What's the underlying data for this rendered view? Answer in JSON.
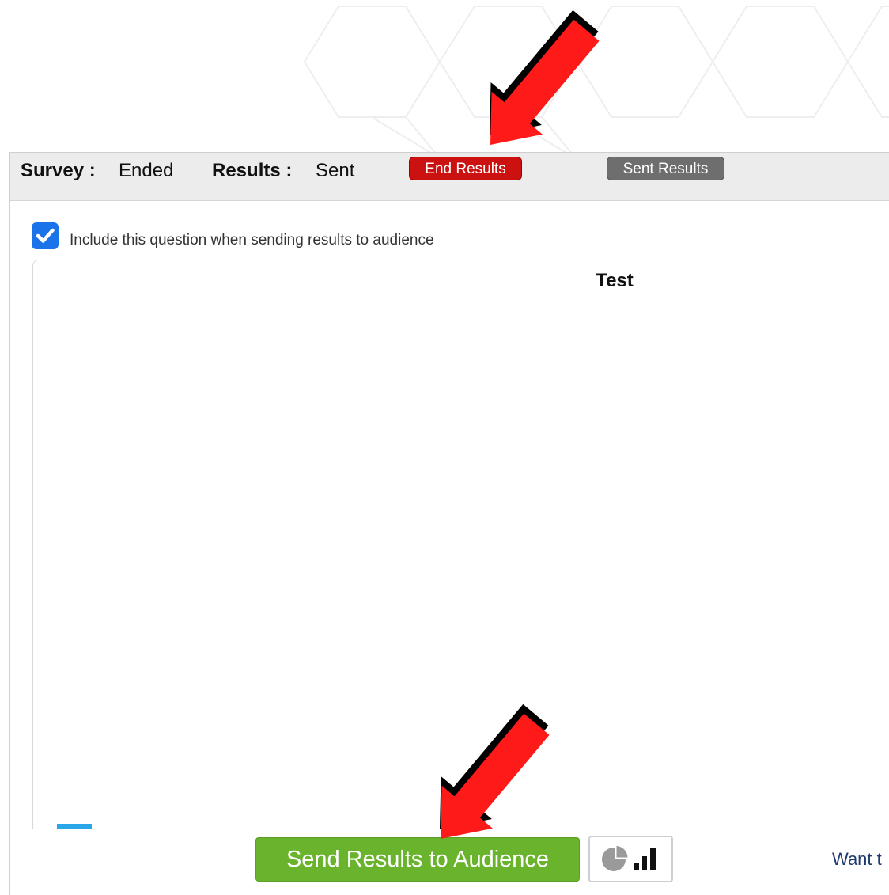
{
  "status": {
    "survey_label": "Survey :",
    "survey_value": "Ended",
    "results_label": "Results :",
    "results_value": "Sent"
  },
  "buttons": {
    "end_results": "End Results",
    "sent_results": "Sent Results"
  },
  "include": {
    "checked": true,
    "text": "Include this question when sending results to audience"
  },
  "chart": {
    "title": "Test"
  },
  "footer": {
    "send_label": "Send Results to Audience",
    "want_text": "Want t"
  },
  "icons": {
    "checkbox": "checkmark-icon",
    "chart_toggle": "pie-bar-chart-icon",
    "annotation": "red-arrow-icon"
  },
  "colors": {
    "end_results": "#cc1111",
    "sent_results": "#6e6e6e",
    "send_button": "#6ab42d",
    "checkbox": "#1a73e8",
    "arrow": "#ff1a1a"
  }
}
